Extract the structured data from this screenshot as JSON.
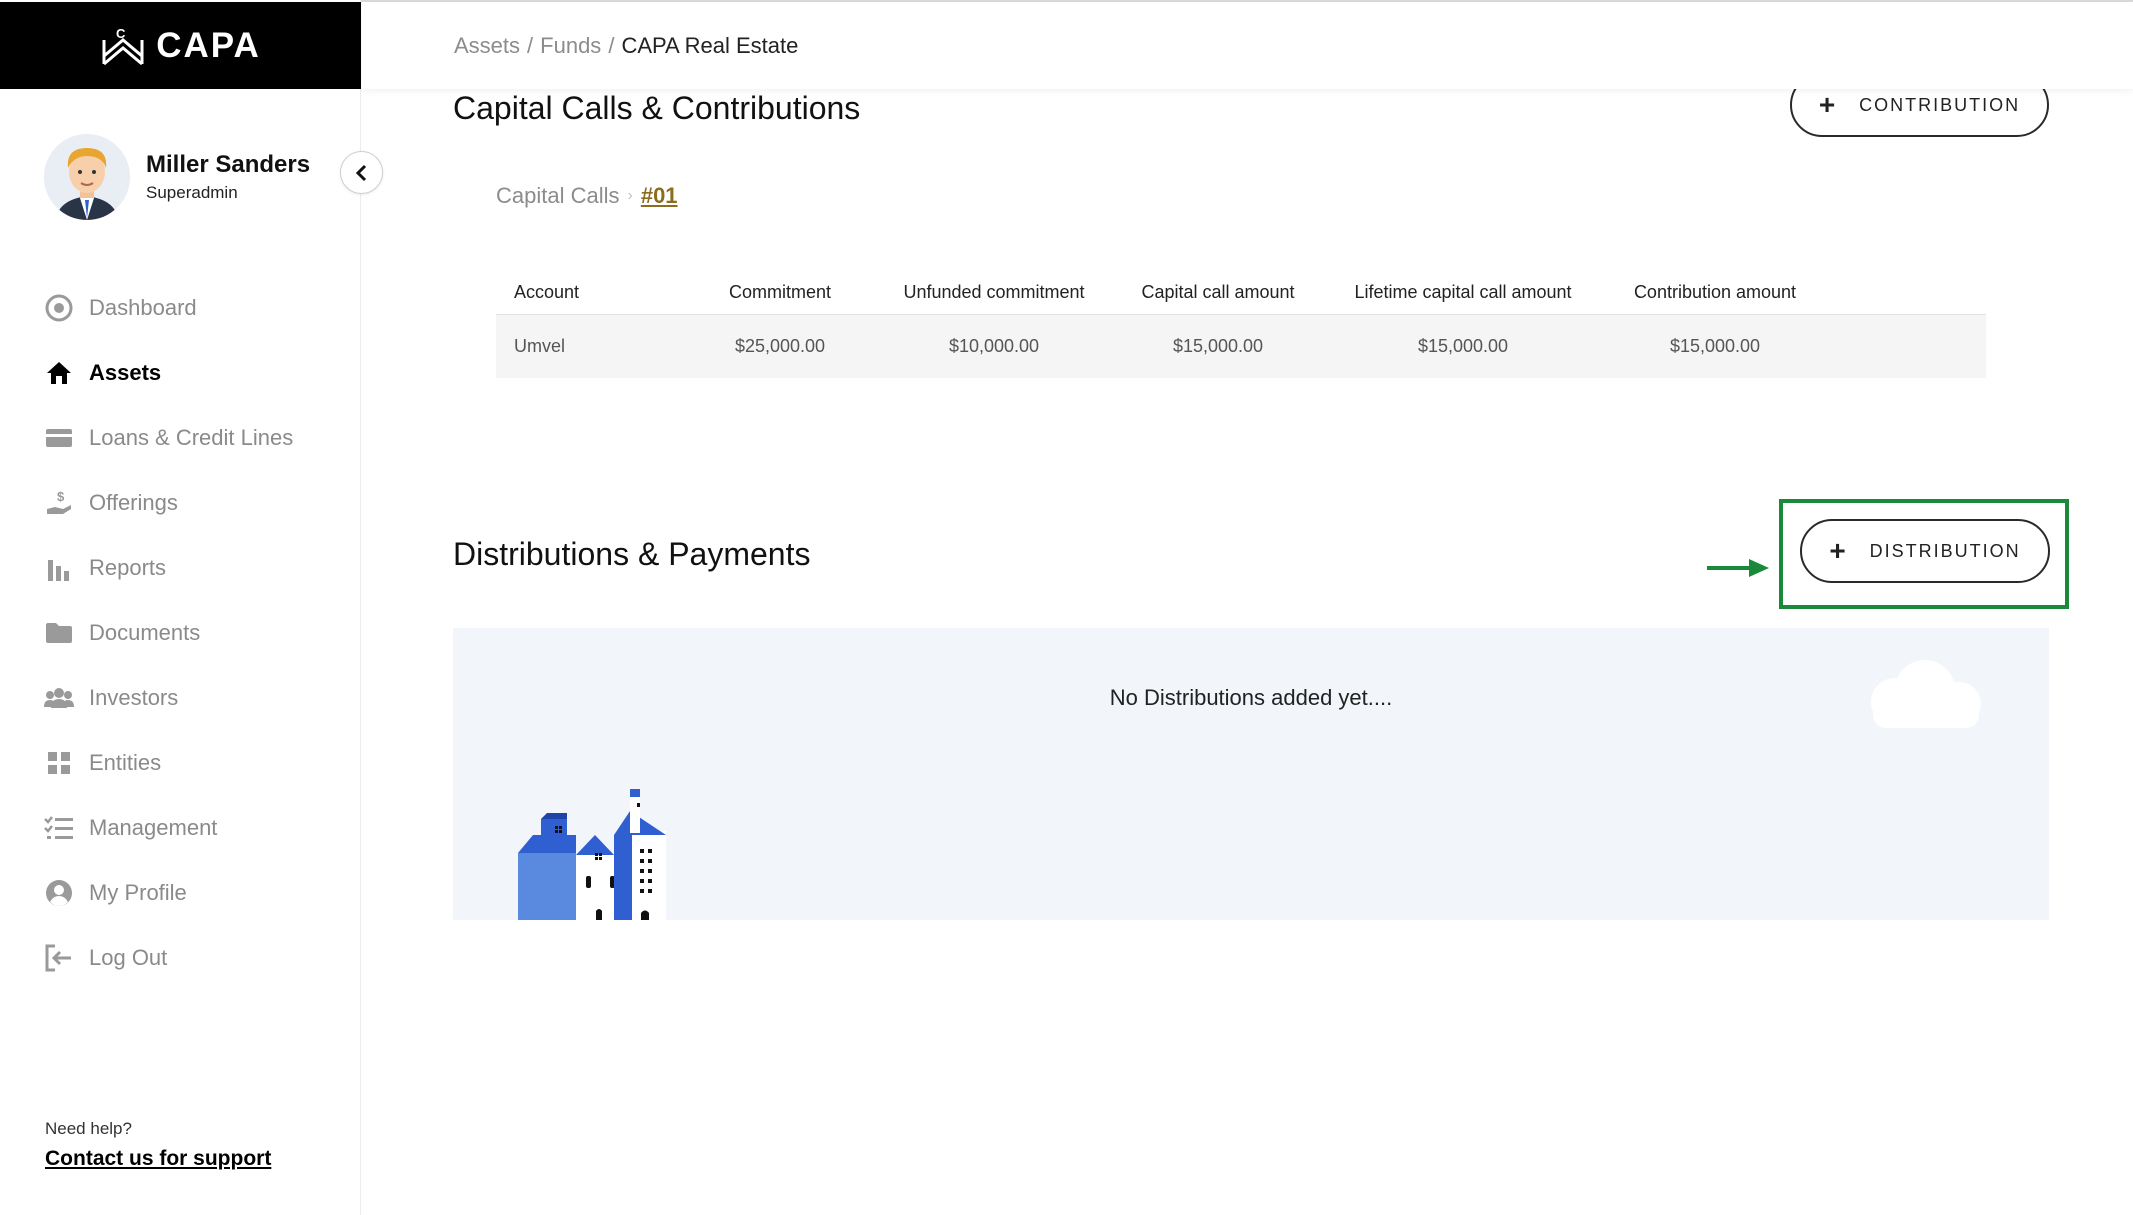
{
  "app": {
    "logo_text": "CAPA"
  },
  "user": {
    "name": "Miller Sanders",
    "role": "Superadmin"
  },
  "sidebar": {
    "items": [
      {
        "label": "Dashboard",
        "icon": "dashboard-icon",
        "active": false
      },
      {
        "label": "Assets",
        "icon": "home-icon",
        "active": true
      },
      {
        "label": "Loans & Credit Lines",
        "icon": "credit-card-icon",
        "active": false
      },
      {
        "label": "Offerings",
        "icon": "hand-dollar-icon",
        "active": false
      },
      {
        "label": "Reports",
        "icon": "bar-chart-icon",
        "active": false
      },
      {
        "label": "Documents",
        "icon": "folder-icon",
        "active": false
      },
      {
        "label": "Investors",
        "icon": "users-icon",
        "active": false
      },
      {
        "label": "Entities",
        "icon": "grid-icon",
        "active": false
      },
      {
        "label": "Management",
        "icon": "checklist-icon",
        "active": false
      },
      {
        "label": "My Profile",
        "icon": "user-circle-icon",
        "active": false
      },
      {
        "label": "Log Out",
        "icon": "logout-icon",
        "active": false
      }
    ],
    "help_question": "Need help?",
    "help_link": "Contact us for support"
  },
  "breadcrumb": {
    "items": [
      "Assets",
      "Funds"
    ],
    "current": "CAPA Real Estate",
    "separator": "/"
  },
  "capital": {
    "title": "Capital Calls & Contributions",
    "button_label": "CONTRIBUTION",
    "sub_crumb": {
      "parent": "Capital Calls",
      "current": "#01"
    },
    "table": {
      "headers": [
        "Account",
        "Commitment",
        "Unfunded commitment",
        "Capital call amount",
        "Lifetime capital call amount",
        "Contribution amount"
      ],
      "rows": [
        [
          "Umvel",
          "$25,000.00",
          "$10,000.00",
          "$15,000.00",
          "$15,000.00",
          "$15,000.00"
        ]
      ]
    }
  },
  "distributions": {
    "title": "Distributions & Payments",
    "button_label": "DISTRIBUTION",
    "empty_message": "No Distributions added yet...."
  },
  "colors": {
    "highlight": "#1a8a3a",
    "accent_link": "#8a6d1e",
    "building_blue": "#2f5fd0",
    "building_light": "#5a8ae0"
  }
}
